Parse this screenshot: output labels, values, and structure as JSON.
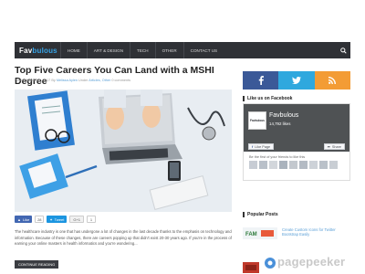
{
  "brand": {
    "part1": "Fav",
    "part2": "bulous"
  },
  "nav": {
    "items": [
      "HOME",
      "ART & DESIGN",
      "TECH",
      "OTHER",
      "CONTACT US"
    ],
    "search_icon": "search-icon"
  },
  "article": {
    "title": "Top Five Careers You Can Land with a MSHI Degree",
    "meta_prefix": "Posted March 21, 2017 By",
    "meta_author": "Melissa Aylen",
    "meta_mid": "Under",
    "meta_categories": "Articles, Other",
    "meta_comments": "0 comments",
    "excerpt": "The healthcare industry is one that has undergone a lot of changes in the last decade thanks to the emphasis on technology and information. Because of these changes, there are careers popping up that didn't exist 20-30 years ago. If you're in the process of earning your online masters in health informatics and you're wondering...",
    "read_more": "CONTINUE READING"
  },
  "share": {
    "like_label": "Like",
    "like_count": "28",
    "tweet_label": "Tweet",
    "gplus_label": "G+1",
    "gplus_count": "1"
  },
  "sidebar": {
    "social_icons": [
      "facebook-icon",
      "twitter-icon",
      "rss-icon"
    ],
    "social_colors": [
      "#3b5998",
      "#2fa8de",
      "#f39c35"
    ],
    "facebook_widget": {
      "title": "Like us on Facebook",
      "avatar_text": "Favbulous",
      "page_name": "Favbulous",
      "likes": "14,792 likes",
      "like_button": "Like Page",
      "share_button": "Share",
      "friends_text": "Be the first of your friends to like this"
    },
    "popular": {
      "title": "Popular Posts",
      "items": [
        {
          "text": "Create Custom Icons for Twitter Bootstrap Easily"
        }
      ]
    }
  },
  "watermark": {
    "text": "pagepeeker"
  },
  "colors": {
    "nav_bg": "#2f3136",
    "accent": "#36a3e6"
  }
}
